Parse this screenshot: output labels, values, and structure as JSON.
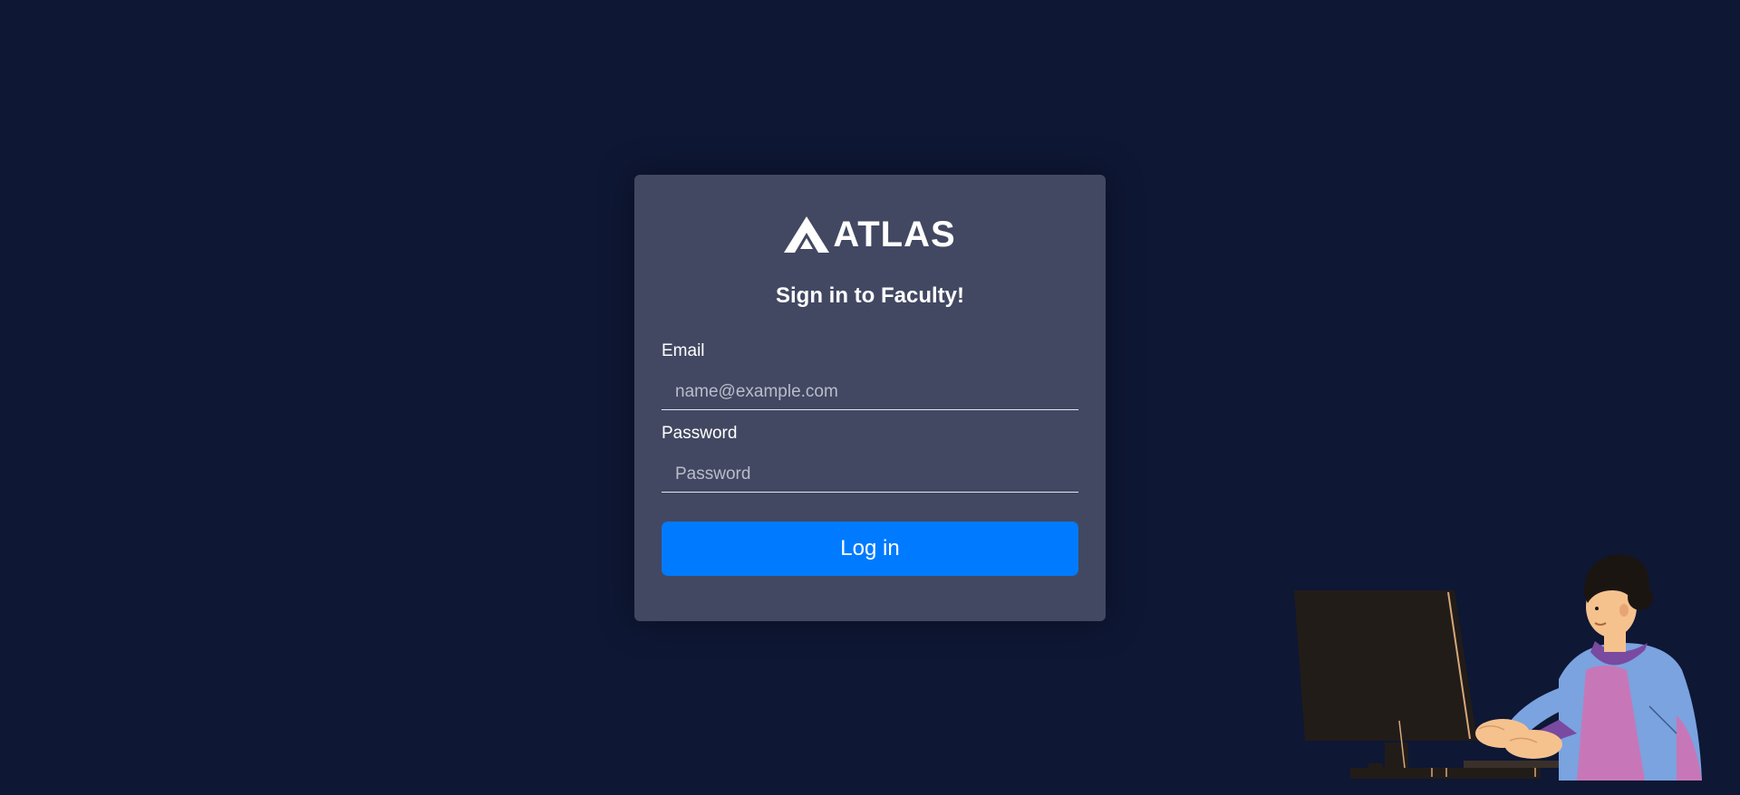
{
  "brand": {
    "name": "ATLAS",
    "logo_icon": "atlas-peak-logo-icon"
  },
  "login": {
    "heading": "Sign in to Faculty!",
    "email_label": "Email",
    "email_placeholder": "name@example.com",
    "email_value": "",
    "password_label": "Password",
    "password_placeholder": "Password",
    "password_value": "",
    "submit_label": "Log in"
  },
  "colors": {
    "background": "#0e1734",
    "card": "#424862",
    "primary_button": "#007bff"
  },
  "illustration": {
    "icon": "person-typing-at-computer-illustration"
  }
}
